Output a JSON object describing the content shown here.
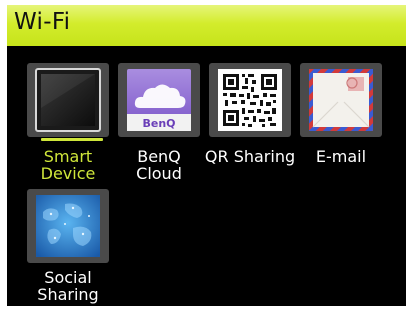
{
  "header": {
    "title": "Wi-Fi"
  },
  "apps": [
    {
      "label": "Smart\nDevice",
      "icon": "smart-device-icon",
      "selected": true
    },
    {
      "label": "BenQ\nCloud",
      "icon": "benq-cloud-icon",
      "logo_text": "BenQ"
    },
    {
      "label": "QR Sharing",
      "icon": "qr-code-icon"
    },
    {
      "label": "E-mail",
      "icon": "envelope-icon"
    },
    {
      "label": "Social\nSharing",
      "icon": "globe-map-icon"
    }
  ],
  "colors": {
    "accent": "#cfe63a",
    "titlebar": "#d3ec2c",
    "background": "#000000"
  }
}
